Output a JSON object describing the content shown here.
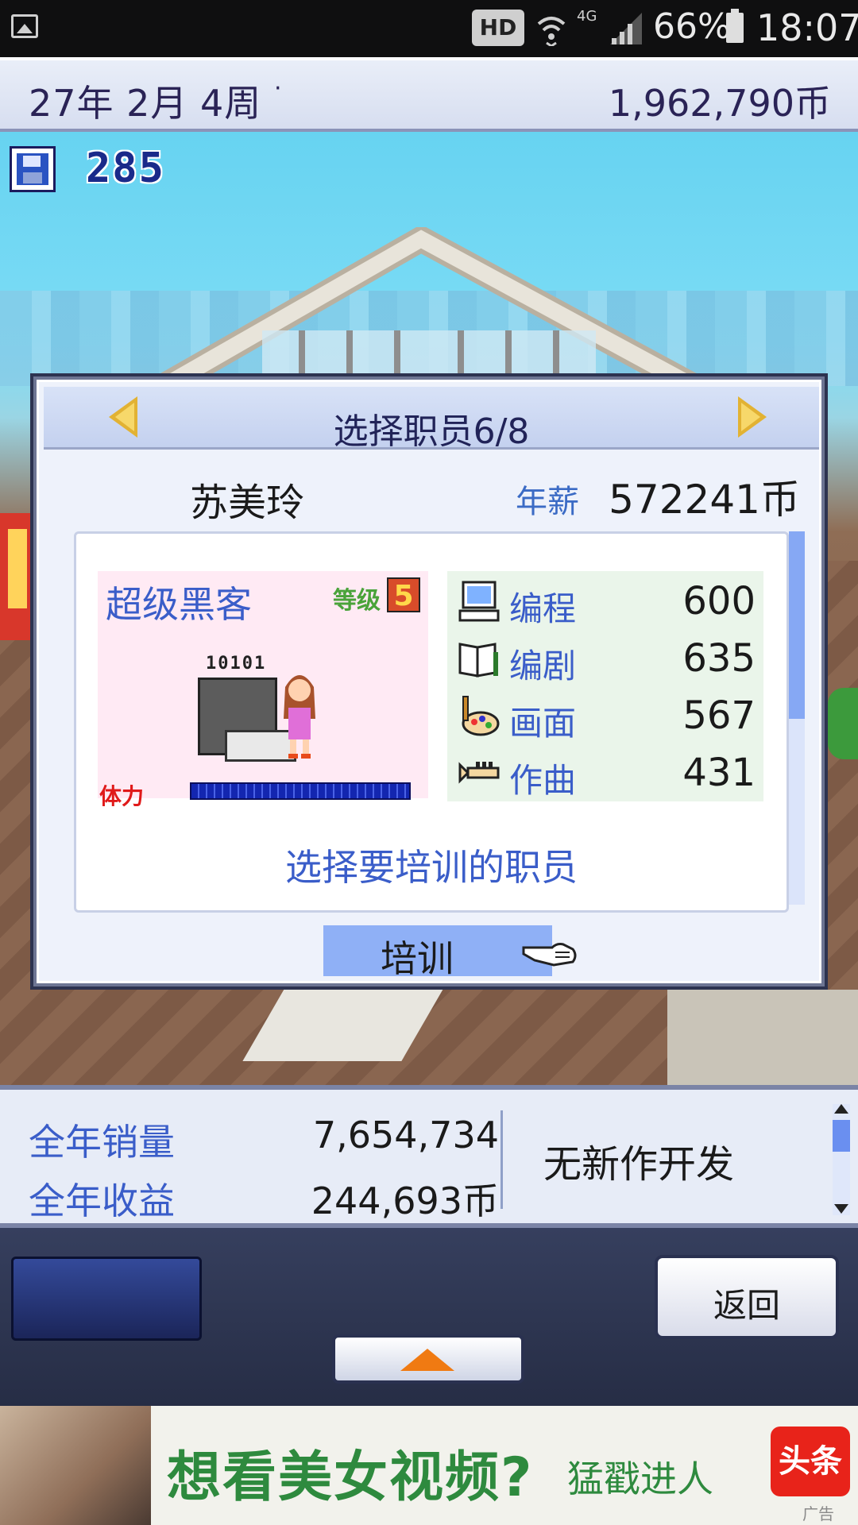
{
  "status_bar": {
    "network_badge": "HD",
    "network_type": "4G",
    "battery": "66%",
    "time": "18:07"
  },
  "top_bar": {
    "date": "27年 2月 4周",
    "date_dot": "·",
    "money": "1,962,790币"
  },
  "scene": {
    "save_count": "285"
  },
  "dialog": {
    "title": "选择职员6/8",
    "employee_name": "苏美玲",
    "salary_label": "年薪",
    "salary_value": "572241币",
    "job_title": "超级黑客",
    "level_label": "等级",
    "level_value": "5",
    "sprite_text": "10101",
    "stamina_label": "体力",
    "stamina_level": 1.0,
    "stats": [
      {
        "icon": "computer-icon",
        "label": "编程",
        "value": "600"
      },
      {
        "icon": "script-book-icon",
        "label": "编剧",
        "value": "635"
      },
      {
        "icon": "palette-icon",
        "label": "画面",
        "value": "567"
      },
      {
        "icon": "trumpet-icon",
        "label": "作曲",
        "value": "431"
      }
    ],
    "prompt": "选择要培训的职员",
    "train_button": "培训"
  },
  "sales_panel": {
    "annual_sales_label": "全年销量",
    "annual_sales_value": "7,654,734",
    "annual_revenue_label": "全年收益",
    "annual_revenue_value": "244,693币",
    "dev_status": "无新作开发"
  },
  "bottom_nav": {
    "back_button": "返回"
  },
  "ad": {
    "headline": "想看美女视频?",
    "cta": "猛戳进人",
    "logo": "头条",
    "tag": "广告"
  },
  "colors": {
    "accent_blue": "#3a5dc9",
    "dialog_header": "#c4d1ef",
    "train_highlight": "#8fb0f6",
    "ad_green": "#2e8a3e"
  }
}
